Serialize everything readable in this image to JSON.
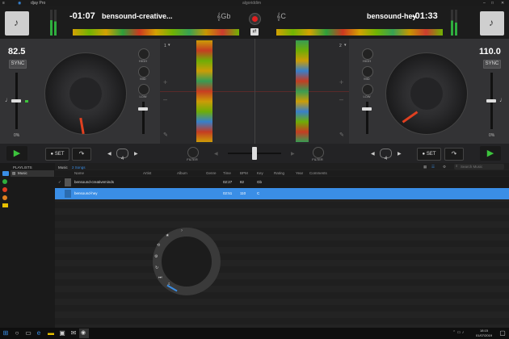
{
  "app": {
    "title": "djay Pro",
    "logo_text": "algoriddim"
  },
  "deck_left": {
    "time": "-01:07",
    "track": "bensound-creative...",
    "key": "Gb",
    "bpm": "82.5",
    "sync_label": "SYNC",
    "pitch": "0%",
    "deck_num": "1",
    "loop": "4",
    "set_label": "SET",
    "eq": {
      "high": "HIGH",
      "mid": "MID",
      "low": "LOW"
    },
    "filter": "FILTER"
  },
  "deck_right": {
    "time": "-01:33",
    "track": "bensound-hey",
    "key": "C",
    "bpm": "110.0",
    "sync_label": "SYNC",
    "pitch": "0%",
    "deck_num": "2",
    "loop": "4",
    "set_label": "SET",
    "eq": {
      "high": "HIGH",
      "mid": "MID",
      "low": "LOW"
    },
    "filter": "FILTER"
  },
  "browser": {
    "section": "PLAYLISTS",
    "sidebar_item": "Music",
    "breadcrumb": "Music",
    "count": "2 Songs",
    "search_placeholder": "Search Music",
    "columns": [
      "Name",
      "Artist",
      "Album",
      "Genre",
      "Time",
      "BPM",
      "Key",
      "Rating",
      "Year",
      "Comments"
    ],
    "rows": [
      {
        "name": "bensound-creativeminds",
        "time": "02:27",
        "bpm": "82",
        "key": "Gb"
      },
      {
        "name": "bensound-hey",
        "time": "02:51",
        "bpm": "110",
        "key": "C"
      }
    ]
  },
  "taskbar": {
    "time": "18:15",
    "date": "01/07/2019"
  },
  "colors": {
    "accent": "#3a8ee6",
    "play": "#3cc43c",
    "record": "#e02020",
    "needle": "#e04020"
  }
}
